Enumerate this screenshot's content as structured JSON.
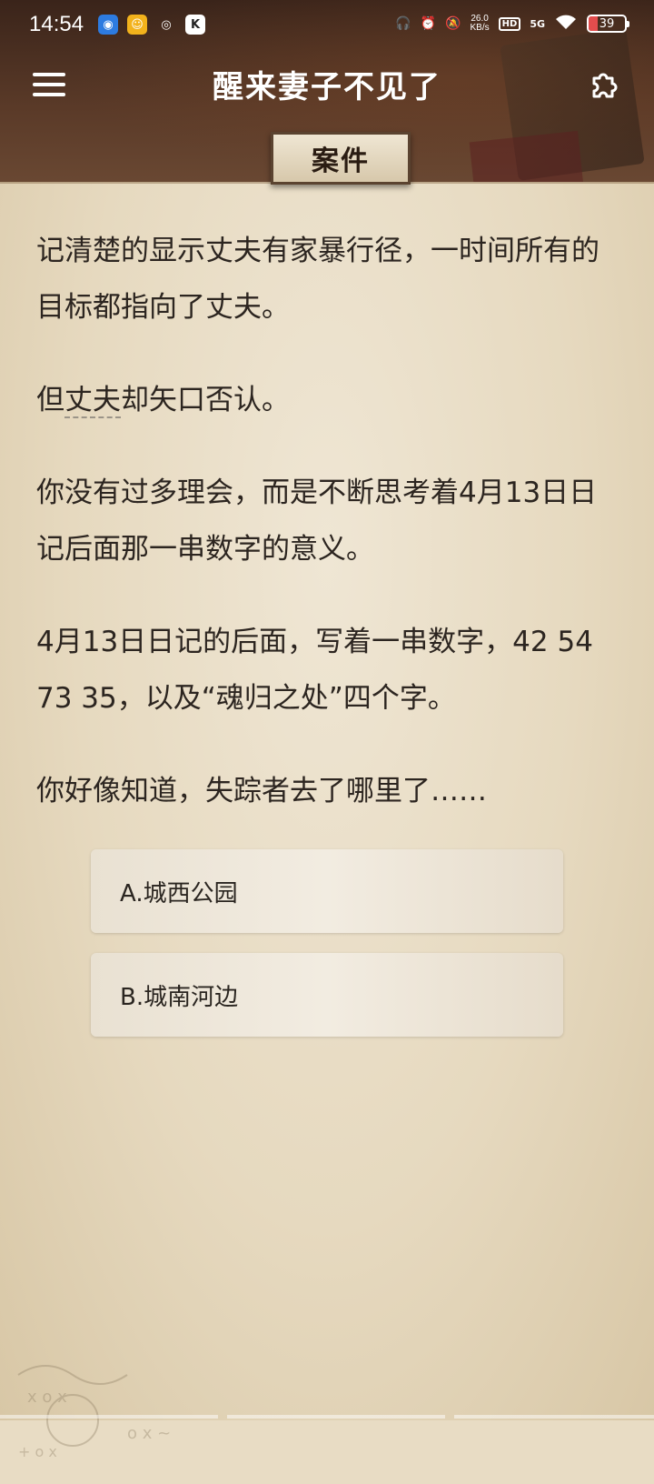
{
  "status_bar": {
    "time": "14:54",
    "net_speed_value": "26.0",
    "net_speed_unit": "KB/s",
    "hd_label": "HD",
    "signal_label": "5G",
    "battery": "39"
  },
  "header": {
    "title": "醒来妻子不见了",
    "tab_label": "案件"
  },
  "story": {
    "paragraphs": [
      "记清楚的显示丈夫有家暴行径，一时间所有的目标都指向了丈夫。",
      "但丈夫却矢口否认。",
      "你没有过多理会，而是不断思考着4月13日日记后面那一串数字的意义。",
      "4月13日日记的后面，写着一串数字，42 54 73 35，以及“魂归之处”四个字。",
      "你好像知道，失踪者去了哪里了……"
    ],
    "p2_prefix": "但",
    "p2_underlined": "丈夫",
    "p2_suffix": "却矢口否认。"
  },
  "options": [
    {
      "label": "A.城西公园"
    },
    {
      "label": "B.城南河边"
    }
  ],
  "icons": {
    "menu": "hamburger-menu-icon",
    "settings": "puzzle-piece-icon"
  }
}
